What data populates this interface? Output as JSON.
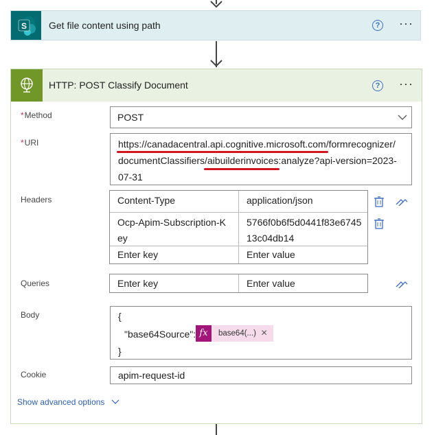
{
  "steps": {
    "get_file": {
      "title": "Get file content using path"
    },
    "http": {
      "title": "HTTP: POST Classify Document",
      "method_label": "Method",
      "method_value": "POST",
      "uri_label": "URI",
      "uri_lines": [
        "https://canadacentral.api.cognitive.microsoft.com/formrecognizer/",
        "documentClassifiers/aibuilderinvoices:analyze?api-version=2023-",
        "07-31"
      ],
      "headers_label": "Headers",
      "headers": [
        {
          "key": "Content-Type",
          "value": "application/json"
        },
        {
          "key_lines": [
            "Ocp-Apim-Subscription-K",
            "ey"
          ],
          "value_lines": [
            "5766f0b6f5d0441f83e6745",
            "13c04db14"
          ]
        }
      ],
      "key_placeholder": "Enter key",
      "value_placeholder": "Enter value",
      "queries_label": "Queries",
      "body_label": "Body",
      "body_open": "{",
      "body_key": "\"base64Source\":",
      "body_token_icon": "fx",
      "body_token": "base64(...)",
      "body_close": "}",
      "cookie_label": "Cookie",
      "cookie_value": "apim-request-id",
      "advanced_label": "Show advanced options",
      "required_mark": "*"
    }
  },
  "icons": {
    "help": "help-circle-icon",
    "more": "more-icon",
    "help_glyph": "?",
    "more_glyph": "···",
    "close_glyph": "×"
  },
  "colors": {
    "sharepoint": "#036c70",
    "http": "#709727",
    "fx": "#a4157a",
    "underline": "#d01420",
    "link": "#2b5fb4"
  }
}
